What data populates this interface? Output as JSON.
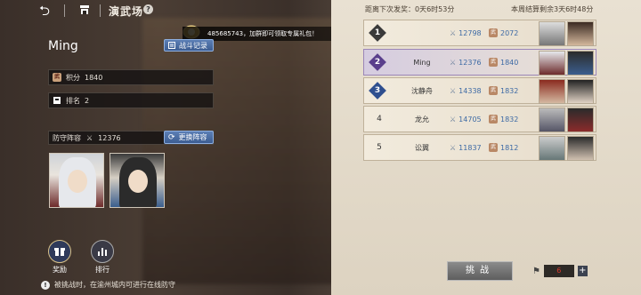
{
  "header": {
    "title": "演武场",
    "back_icon": "back-arrow-icon",
    "home_icon": "home-icon",
    "help_icon": "help-icon"
  },
  "banner": {
    "text": "485685743，加群即可领取专属礼包！"
  },
  "player": {
    "name": "Ming",
    "battle_log_label": "战斗记录",
    "score_label": "积分",
    "score_value": "1840",
    "rank_label": "排名",
    "rank_value": "2",
    "defense_label": "防守阵容",
    "defense_power": "12376",
    "change_lineup_label": "更换阵容"
  },
  "bottom": {
    "reward_label": "奖励",
    "ranking_label": "排行",
    "info_text": "被挑战时，在渝州城内可进行在线防守"
  },
  "panel": {
    "next_attack": "距离下次发奖：0天6时53分",
    "weekly_remaining": "本周结算剩余3天6时48分",
    "rows": [
      {
        "rank": "1",
        "name": "",
        "power": "12798",
        "score": "2072",
        "highlight": false
      },
      {
        "rank": "2",
        "name": "Ming",
        "power": "12376",
        "score": "1840",
        "highlight": true
      },
      {
        "rank": "3",
        "name": "沈静舟",
        "power": "14338",
        "score": "1832",
        "highlight": false
      },
      {
        "rank": "4",
        "name": "龙允",
        "power": "14705",
        "score": "1832",
        "highlight": false
      },
      {
        "rank": "5",
        "name": "讼翼",
        "power": "11837",
        "score": "1812",
        "highlight": false
      }
    ],
    "challenge_label": "挑战",
    "ticket_count": "6"
  },
  "colors": {
    "accent_blue": "#4a6da6",
    "rank_purple": "#5a3f8c",
    "rank_blue": "#2f4f8f",
    "ticket_red": "#d73b2e"
  }
}
